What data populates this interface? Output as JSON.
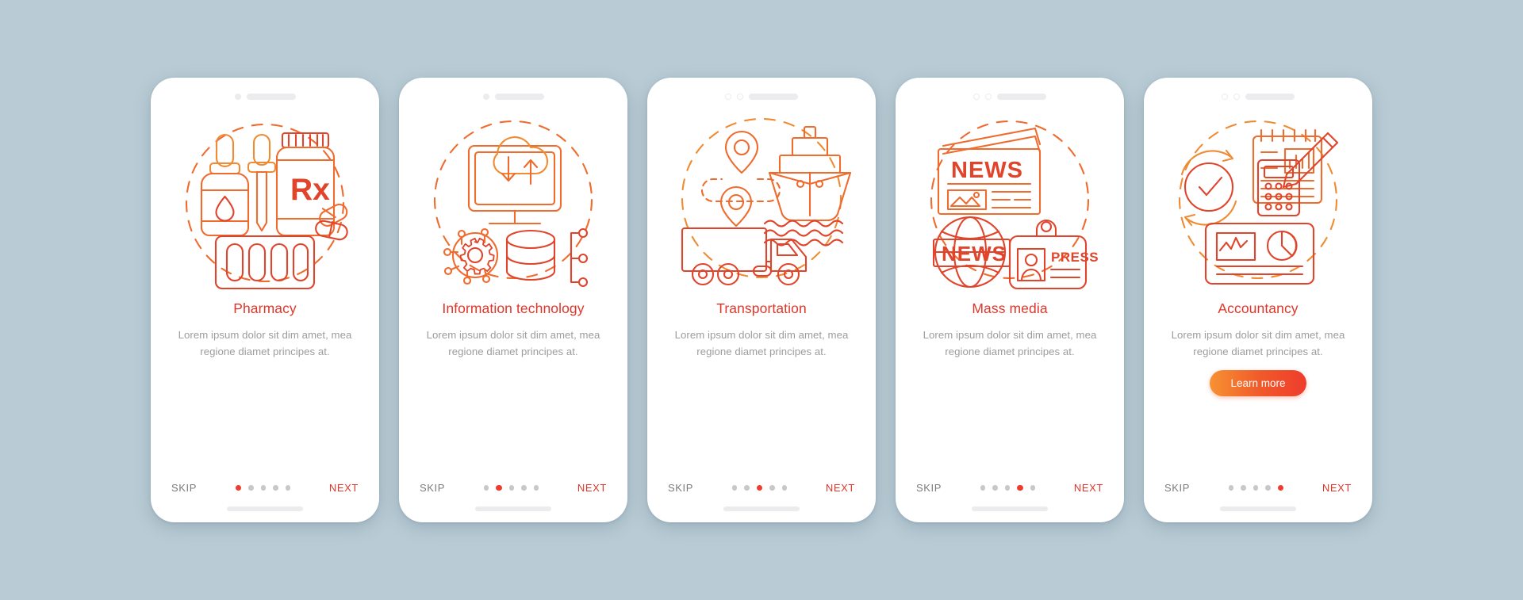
{
  "theme": {
    "background": "#b9ccd6",
    "card_background": "#ffffff",
    "title_color": "#e0362a",
    "body_text_color": "#9c9c9c",
    "skip_color": "#7c7c7c",
    "next_color": "#e0362a",
    "dot_active_color": "#ef3c2c",
    "dot_inactive_color": "#c8c8c8",
    "cta_gradient_from": "#f79232",
    "cta_gradient_to": "#ef3c2c"
  },
  "common": {
    "skip_label": "SKIP",
    "next_label": "NEXT",
    "description": "Lorem ipsum dolor sit dim amet, mea regione diamet principes at.",
    "total_dots": 5
  },
  "screens": [
    {
      "id": "pharmacy",
      "title": "Pharmacy",
      "description": "Lorem ipsum dolor sit dim amet, mea regione diamet principes at.",
      "skip_label": "SKIP",
      "next_label": "NEXT",
      "active_dot": 1,
      "illustration": "pharmacy-illustration",
      "illustration_parts": [
        "dropper-bottle",
        "pipette",
        "rx-pill-bottle",
        "capsules",
        "pill-blister-pack",
        "dashed-circle"
      ],
      "cta": null
    },
    {
      "id": "information-technology",
      "title": "Information technology",
      "description": "Lorem ipsum dolor sit dim amet, mea regione diamet principes at.",
      "skip_label": "SKIP",
      "next_label": "NEXT",
      "active_dot": 2,
      "illustration": "information-technology-illustration",
      "illustration_parts": [
        "cloud",
        "monitor",
        "upload-download-arrows",
        "gear-network",
        "database-cylinder",
        "node-tree",
        "dashed-circle"
      ],
      "cta": null
    },
    {
      "id": "transportation",
      "title": "Transportation",
      "description": "Lorem ipsum dolor sit dim amet, mea regione diamet principes at.",
      "skip_label": "SKIP",
      "next_label": "NEXT",
      "active_dot": 3,
      "illustration": "transportation-illustration",
      "illustration_parts": [
        "map-pin-upper",
        "map-pin-lower",
        "dashed-route",
        "cargo-ship",
        "water-waves",
        "delivery-truck",
        "dashed-circle"
      ],
      "cta": null
    },
    {
      "id": "mass-media",
      "title": "Mass media",
      "description": "Lorem ipsum dolor sit dim amet, mea regione diamet principes at.",
      "skip_label": "SKIP",
      "next_label": "NEXT",
      "active_dot": 4,
      "illustration": "mass-media-illustration",
      "illustration_parts": [
        "newspaper",
        "globe",
        "news-banner",
        "press-badge",
        "dashed-circle"
      ],
      "illustration_text": {
        "newspaper_headline": "NEWS",
        "globe_banner": "NEWS",
        "badge_label": "PRESS"
      },
      "cta": null
    },
    {
      "id": "accountancy",
      "title": "Accountancy",
      "description": "Lorem ipsum dolor sit dim amet, mea regione diamet principes at.",
      "skip_label": "SKIP",
      "next_label": "NEXT",
      "active_dot": 5,
      "illustration": "accountancy-illustration",
      "illustration_parts": [
        "checkmark-refresh-cycle",
        "notepad-chart",
        "pencil",
        "calculator",
        "report-chart-card",
        "dashed-circle"
      ],
      "cta": {
        "label": "Learn more"
      }
    }
  ]
}
